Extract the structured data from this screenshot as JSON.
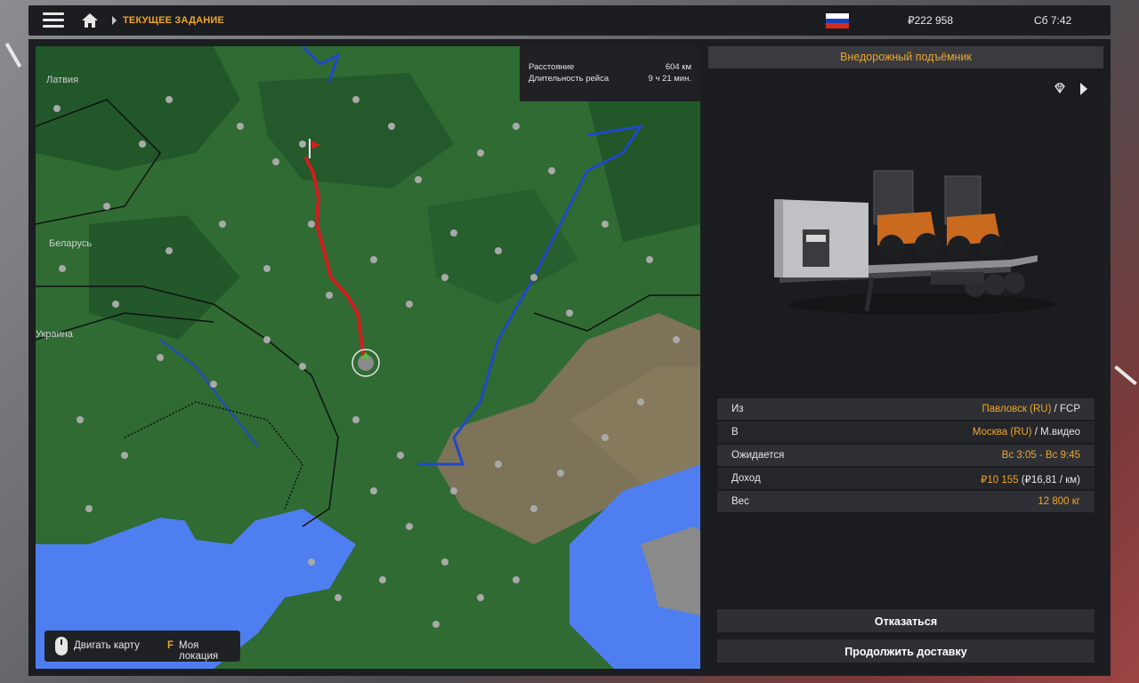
{
  "header": {
    "breadcrumb": "ТЕКУЩЕЕ ЗАДАНИЕ",
    "money": "₽222 958",
    "clock": "Сб 7:42"
  },
  "map": {
    "labels": {
      "latvia": "Латвия",
      "belarus": "Беларусь",
      "ukraine": "Украина"
    },
    "stats": {
      "distance_label": "Расстояние",
      "distance_value": "604 км",
      "duration_label": "Длительность рейса",
      "duration_value": "9 ч 21 мин."
    },
    "hint": {
      "move_label": "Двигать карту",
      "key": "F",
      "location_label": "Моя локация"
    }
  },
  "cargo": {
    "title": "Внедорожный подъёмник"
  },
  "details": {
    "from": {
      "label": "Из",
      "city": "Павловск (RU)",
      "company": " / FCP"
    },
    "to": {
      "label": "В",
      "city": "Москва (RU)",
      "company": " / М.видео"
    },
    "expected": {
      "label": "Ожидается",
      "value": "Вс 3:05 - Вс 9:45"
    },
    "income": {
      "label": "Доход",
      "value": "₽10 155",
      "rate": " (₽16,81 / км)"
    },
    "weight": {
      "label": "Вес",
      "value": "12 800 кг"
    }
  },
  "actions": {
    "decline": "Отказаться",
    "continue": "Продолжить доставку"
  },
  "colors": {
    "accent": "#f0a627",
    "route": "#d01e1e",
    "land": "#2f6b33",
    "sea": "#4f7ef0",
    "steppe": "#7d7358"
  }
}
